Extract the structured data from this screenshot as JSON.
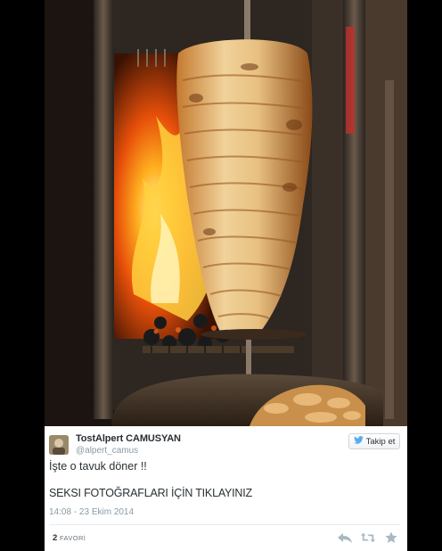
{
  "tweet": {
    "author_name": "TostAlpert CAMUSYAN",
    "author_handle": "@alpert_camus",
    "follow_label": "Takip et",
    "text": "İşte o tavuk döner !!",
    "link_text": "SEKSI FOTOĞRAFLARI İÇİN TIKLAYINIZ",
    "timestamp": "14:08 - 23 Ekim 2014",
    "favorites_count": "2",
    "favorites_label": "FAVORİ"
  },
  "photo": {
    "subject": "doner kebab rotating on a spit in front of a fire"
  },
  "icons": {
    "follow": "twitter-bird-icon",
    "reply": "reply-icon",
    "retweet": "retweet-icon",
    "favorite": "star-icon"
  },
  "colors": {
    "follow_bird": "#55acee",
    "muted_text": "#8899a6",
    "action_icons": "#aab8c2"
  }
}
